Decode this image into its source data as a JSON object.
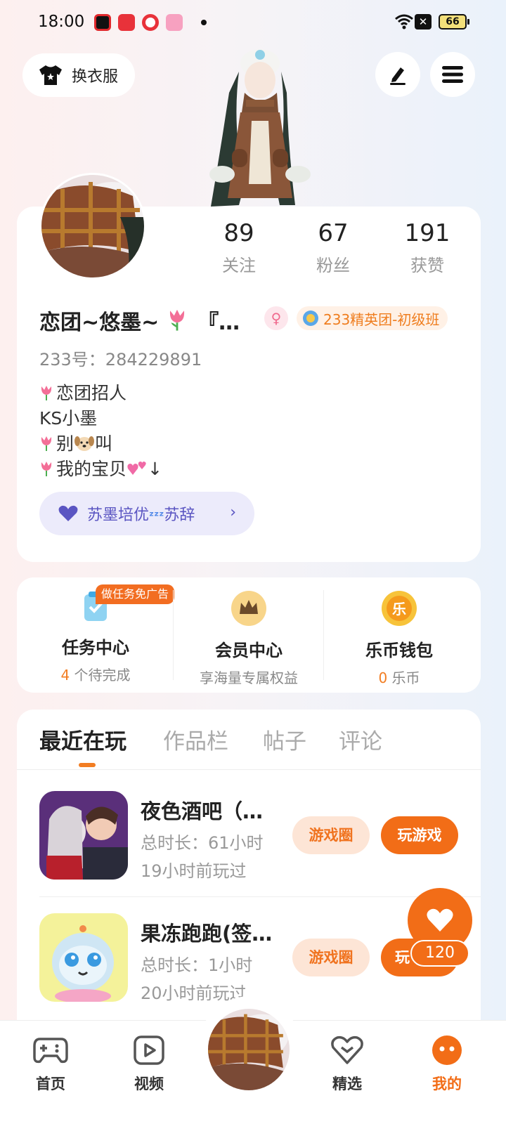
{
  "status_bar": {
    "time": "18:00",
    "battery": "66"
  },
  "header": {
    "outfit_label": "换衣服"
  },
  "profile": {
    "stats": [
      {
        "value": "89",
        "label": "关注"
      },
      {
        "value": "67",
        "label": "粉丝"
      },
      {
        "value": "191",
        "label": "获赞"
      }
    ],
    "nickname": "恋团~悠墨~",
    "nickname_suffix": "『…",
    "gender_icon": "♀",
    "tier_badge": "233精英团-初级班",
    "user_id": "233号：284229891",
    "bio_lines": [
      "恋团招人",
      "KS小墨",
      "别",
      "叫",
      "我的宝贝",
      "↓"
    ],
    "guild_label": "苏墨培优",
    "guild_label_suffix": "苏辞"
  },
  "services": [
    {
      "title": "任务中心",
      "count": "4",
      "sub": "个待完成",
      "tag": "做任务免广告"
    },
    {
      "title": "会员中心",
      "sub": "享海量专属权益"
    },
    {
      "title": "乐币钱包",
      "count": "0",
      "sub": "乐币",
      "coin_glyph": "乐"
    }
  ],
  "tabs": [
    "最近在玩",
    "作品栏",
    "帖子",
    "评论"
  ],
  "games": [
    {
      "name": "夜色酒吧（…",
      "total_time": "总时长：61小时",
      "last_played": "19小时前玩过",
      "circle_label": "游戏圈",
      "play_label": "玩游戏"
    },
    {
      "name": "果冻跑跑(签…",
      "total_time": "总时长：1小时",
      "last_played": "20小时前玩过",
      "circle_label": "游戏圈",
      "play_label": "玩"
    }
  ],
  "like_count": "120",
  "bottom_nav": [
    {
      "label": "首页",
      "icon": "gamepad-icon"
    },
    {
      "label": "视频",
      "icon": "video-play-icon"
    },
    {
      "label": "精选",
      "icon": "heart-diamond-icon"
    },
    {
      "label": "我的",
      "icon": "face-icon"
    }
  ],
  "colors": {
    "accent": "#f26d17",
    "guild": "#5a55c2",
    "gender": "#f06a8e"
  }
}
